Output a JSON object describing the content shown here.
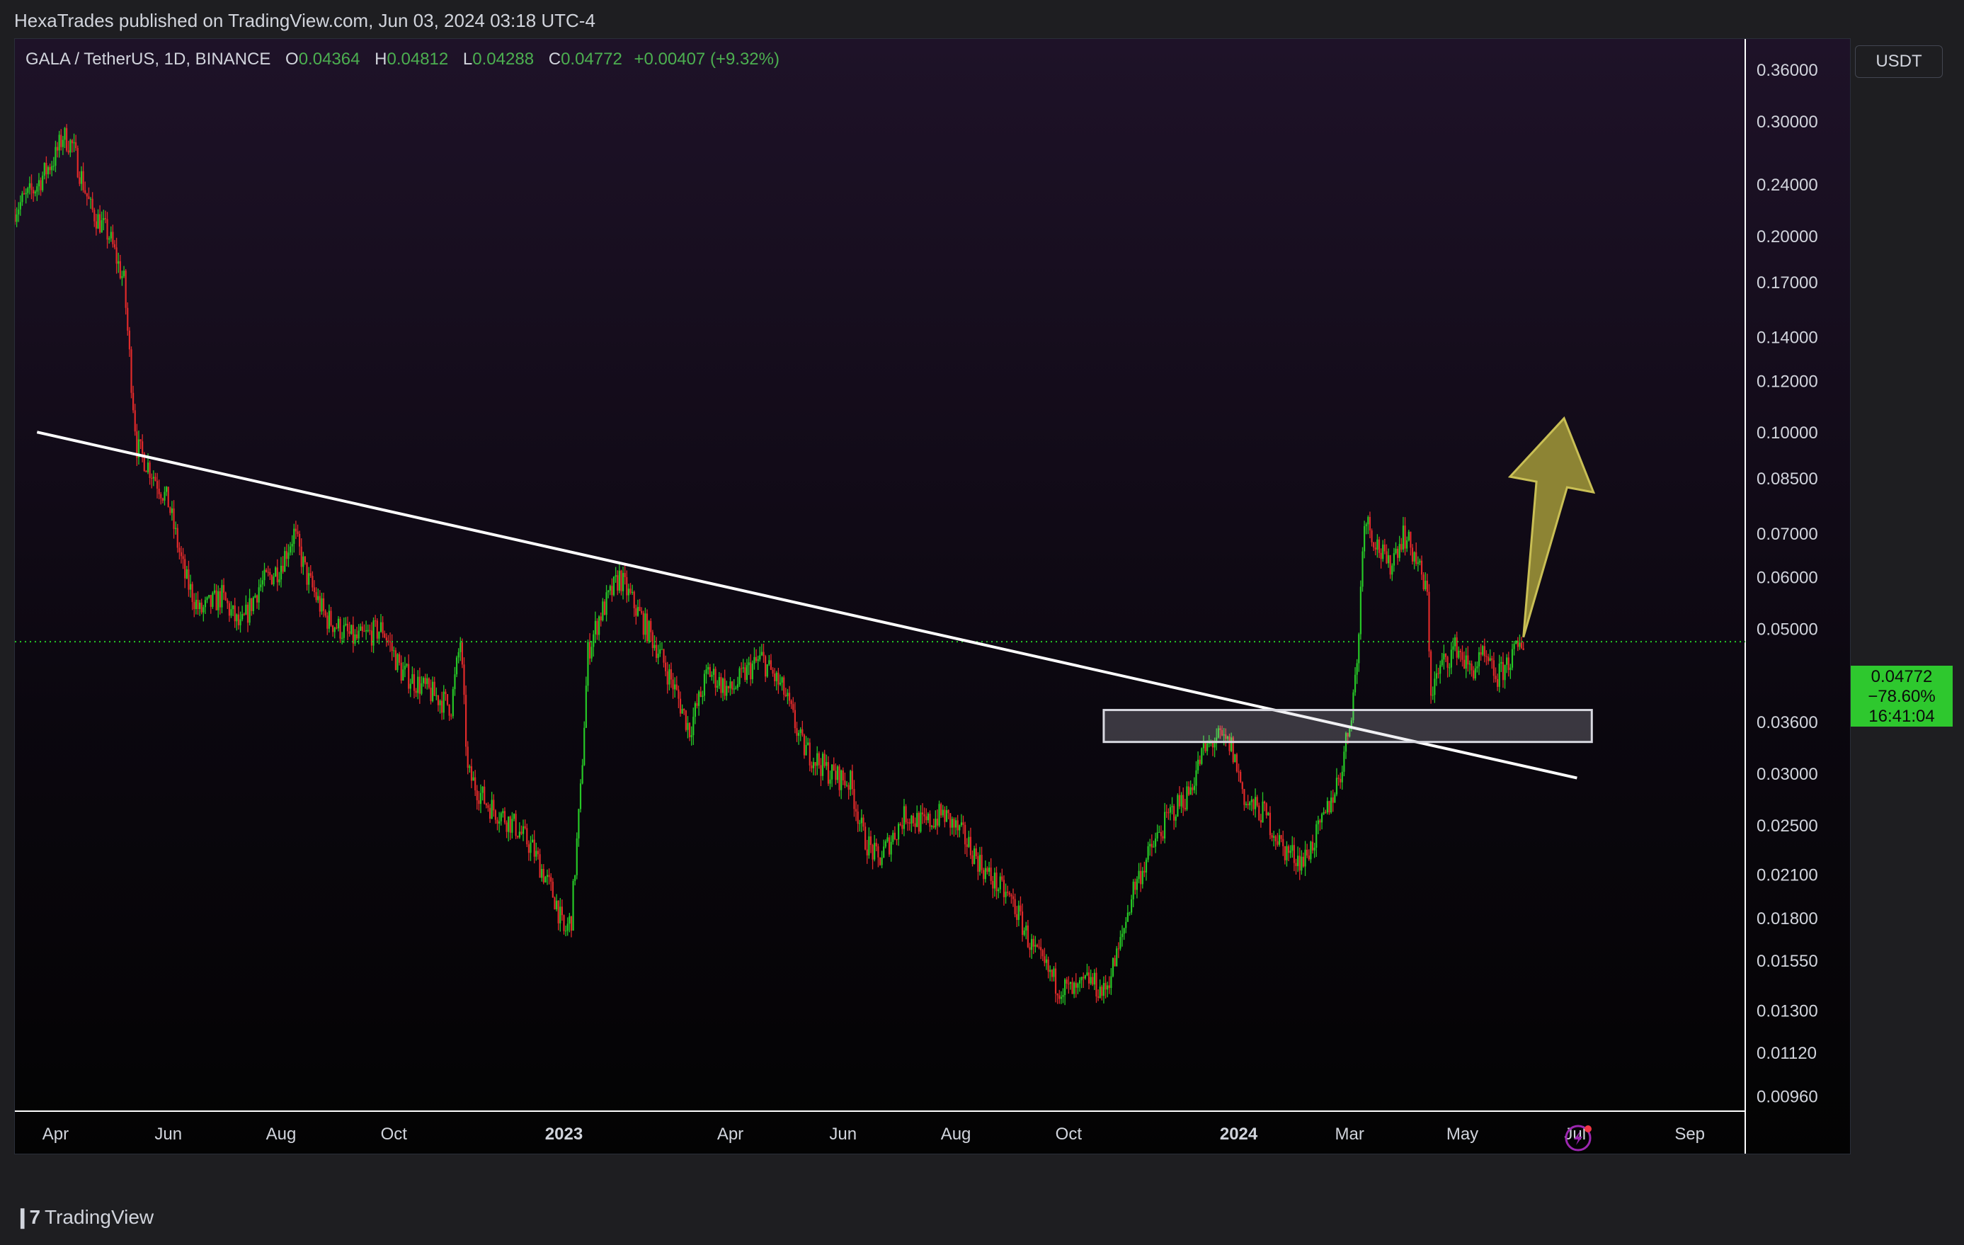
{
  "header": {
    "publisher_line": "HexaTrades published on TradingView.com, Jun 03, 2024 03:18 UTC-4"
  },
  "legend": {
    "symbol": "GALA / TetherUS, 1D, BINANCE",
    "open_label": "O",
    "open": "0.04364",
    "high_label": "H",
    "high": "0.04812",
    "low_label": "L",
    "low": "0.04288",
    "close_label": "C",
    "close": "0.04772",
    "change": "+0.00407 (+9.32%)"
  },
  "currency_button": "USDT",
  "price_label": {
    "price": "0.04772",
    "percent": "−78.60%",
    "countdown": "16:41:04"
  },
  "footer": {
    "brand": "TradingView",
    "logo_icon": "tradingview-logo-icon"
  },
  "colors": {
    "up": "#26c826",
    "down": "#e02a2a",
    "trendline": "#ffffff",
    "arrow": "#a39a3a",
    "price_line": "#26c826"
  },
  "chart_data": {
    "type": "candlestick",
    "scale": "log",
    "ylim": [
      0.0091,
      0.385
    ],
    "xlim": [
      "2022-03-10",
      "2024-10-01"
    ],
    "y_ticks": [
      "0.36000",
      "0.30000",
      "0.24000",
      "0.20000",
      "0.17000",
      "0.14000",
      "0.12000",
      "0.10000",
      "0.08500",
      "0.07000",
      "0.06000",
      "0.05000",
      "0.03600",
      "0.03000",
      "0.02500",
      "0.02100",
      "0.01800",
      "0.01550",
      "0.01300",
      "0.01120",
      "0.00960"
    ],
    "x_ticks": [
      {
        "label": "Apr",
        "date": "2022-04-01",
        "bold": false
      },
      {
        "label": "Jun",
        "date": "2022-06-01",
        "bold": false
      },
      {
        "label": "Aug",
        "date": "2022-08-01",
        "bold": false
      },
      {
        "label": "Oct",
        "date": "2022-10-01",
        "bold": false
      },
      {
        "label": "2023",
        "date": "2023-01-01",
        "bold": true
      },
      {
        "label": "Apr",
        "date": "2023-04-01",
        "bold": false
      },
      {
        "label": "Jun",
        "date": "2023-06-01",
        "bold": false
      },
      {
        "label": "Aug",
        "date": "2023-08-01",
        "bold": false
      },
      {
        "label": "Oct",
        "date": "2023-10-01",
        "bold": false
      },
      {
        "label": "2024",
        "date": "2024-01-01",
        "bold": true
      },
      {
        "label": "Mar",
        "date": "2024-03-01",
        "bold": false
      },
      {
        "label": "May",
        "date": "2024-05-01",
        "bold": false
      },
      {
        "label": "Jul",
        "date": "2024-07-01",
        "bold": false
      },
      {
        "label": "Sep",
        "date": "2024-09-01",
        "bold": false
      }
    ],
    "price_path": [
      [
        "2022-03-10",
        0.22
      ],
      [
        "2022-03-20",
        0.235
      ],
      [
        "2022-04-01",
        0.265
      ],
      [
        "2022-04-05",
        0.285
      ],
      [
        "2022-04-10",
        0.275
      ],
      [
        "2022-04-20",
        0.22
      ],
      [
        "2022-04-30",
        0.2
      ],
      [
        "2022-05-08",
        0.17
      ],
      [
        "2022-05-12",
        0.12
      ],
      [
        "2022-05-15",
        0.095
      ],
      [
        "2022-05-20",
        0.09
      ],
      [
        "2022-05-25",
        0.085
      ],
      [
        "2022-06-01",
        0.078
      ],
      [
        "2022-06-10",
        0.06
      ],
      [
        "2022-06-18",
        0.053
      ],
      [
        "2022-06-30",
        0.056
      ],
      [
        "2022-07-10",
        0.05
      ],
      [
        "2022-07-20",
        0.058
      ],
      [
        "2022-07-31",
        0.062
      ],
      [
        "2022-08-08",
        0.07
      ],
      [
        "2022-08-15",
        0.06
      ],
      [
        "2022-08-25",
        0.052
      ],
      [
        "2022-09-10",
        0.048
      ],
      [
        "2022-09-25",
        0.05
      ],
      [
        "2022-10-05",
        0.043
      ],
      [
        "2022-10-20",
        0.04
      ],
      [
        "2022-11-01",
        0.038
      ],
      [
        "2022-11-06",
        0.048
      ],
      [
        "2022-11-10",
        0.03
      ],
      [
        "2022-11-20",
        0.027
      ],
      [
        "2022-12-05",
        0.025
      ],
      [
        "2022-12-15",
        0.023
      ],
      [
        "2022-12-28",
        0.019
      ],
      [
        "2023-01-01",
        0.017
      ],
      [
        "2023-01-05",
        0.018
      ],
      [
        "2023-01-10",
        0.028
      ],
      [
        "2023-01-14",
        0.046
      ],
      [
        "2023-01-20",
        0.052
      ],
      [
        "2023-01-31",
        0.06
      ],
      [
        "2023-02-10",
        0.053
      ],
      [
        "2023-02-20",
        0.047
      ],
      [
        "2023-03-01",
        0.041
      ],
      [
        "2023-03-10",
        0.035
      ],
      [
        "2023-03-20",
        0.043
      ],
      [
        "2023-04-01",
        0.04
      ],
      [
        "2023-04-10",
        0.043
      ],
      [
        "2023-04-18",
        0.045
      ],
      [
        "2023-04-30",
        0.04
      ],
      [
        "2023-05-10",
        0.033
      ],
      [
        "2023-05-25",
        0.03
      ],
      [
        "2023-06-05",
        0.029
      ],
      [
        "2023-06-12",
        0.024
      ],
      [
        "2023-06-20",
        0.022
      ],
      [
        "2023-07-05",
        0.026
      ],
      [
        "2023-07-15",
        0.025
      ],
      [
        "2023-07-25",
        0.026
      ],
      [
        "2023-08-05",
        0.024
      ],
      [
        "2023-08-18",
        0.021
      ],
      [
        "2023-09-01",
        0.019
      ],
      [
        "2023-09-12",
        0.016
      ],
      [
        "2023-09-25",
        0.0142
      ],
      [
        "2023-10-05",
        0.0138
      ],
      [
        "2023-10-12",
        0.0145
      ],
      [
        "2023-10-20",
        0.0138
      ],
      [
        "2023-10-28",
        0.016
      ],
      [
        "2023-11-05",
        0.02
      ],
      [
        "2023-11-15",
        0.023
      ],
      [
        "2023-11-25",
        0.026
      ],
      [
        "2023-12-05",
        0.028
      ],
      [
        "2023-12-12",
        0.032
      ],
      [
        "2023-12-20",
        0.034
      ],
      [
        "2023-12-28",
        0.033
      ],
      [
        "2024-01-05",
        0.027
      ],
      [
        "2024-01-15",
        0.026
      ],
      [
        "2024-01-25",
        0.023
      ],
      [
        "2024-02-05",
        0.022
      ],
      [
        "2024-02-15",
        0.025
      ],
      [
        "2024-02-25",
        0.03
      ],
      [
        "2024-03-01",
        0.036
      ],
      [
        "2024-03-05",
        0.044
      ],
      [
        "2024-03-09",
        0.075
      ],
      [
        "2024-03-15",
        0.068
      ],
      [
        "2024-03-22",
        0.062
      ],
      [
        "2024-03-30",
        0.07
      ],
      [
        "2024-04-06",
        0.064
      ],
      [
        "2024-04-12",
        0.056
      ],
      [
        "2024-04-14",
        0.04
      ],
      [
        "2024-04-20",
        0.044
      ],
      [
        "2024-04-28",
        0.047
      ],
      [
        "2024-05-05",
        0.043
      ],
      [
        "2024-05-12",
        0.045
      ],
      [
        "2024-05-20",
        0.042
      ],
      [
        "2024-05-27",
        0.045
      ],
      [
        "2024-06-03",
        0.0477
      ]
    ],
    "annotations": {
      "trendline": [
        [
          "2022-03-22",
          0.1
        ],
        [
          "2024-07-02",
          0.0295
        ]
      ],
      "support_zone": {
        "x0": "2023-10-20",
        "x1": "2024-07-10",
        "y_low": 0.0335,
        "y_high": 0.0375
      },
      "arrow": {
        "from": [
          "2024-06-03",
          0.0485
        ],
        "to": [
          "2024-06-25",
          0.105
        ]
      },
      "last_price_line": 0.04772
    }
  }
}
